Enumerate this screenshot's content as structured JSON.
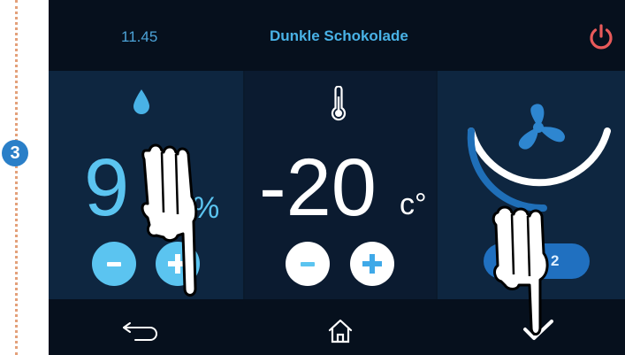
{
  "step": {
    "number": "3"
  },
  "header": {
    "time": "11.45",
    "program_name": "Dunkle Schokolade"
  },
  "humidity": {
    "value": "9",
    "unit": "%"
  },
  "temperature": {
    "value": "-20",
    "unit": "c°"
  },
  "fan": {
    "speed_label": "2"
  },
  "icons": {
    "power": "power-icon",
    "humidity": "water-drop-icon",
    "temperature": "thermometer-icon",
    "fan": "fan-icon",
    "back": "back-arrow-icon",
    "home": "home-icon",
    "confirm": "checkmark-icon"
  },
  "colors": {
    "accent": "#49b2e6",
    "power": "#e85a5a",
    "button_light": "#5bc4f0",
    "fan_arc": "#1f6fb8"
  }
}
